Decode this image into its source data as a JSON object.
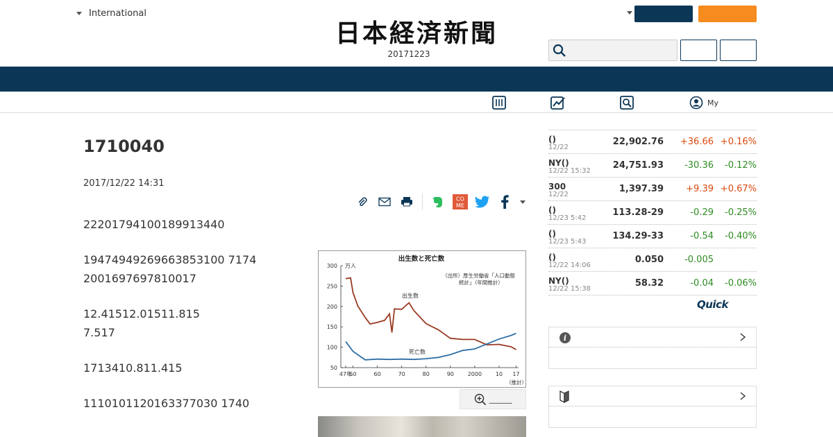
{
  "header": {
    "region_label": "International",
    "logo_text": "日本経済新聞",
    "date": "20171223",
    "search_placeholder": ""
  },
  "subnav": {
    "items": [
      {
        "icon": "keypad-icon",
        "label": ""
      },
      {
        "icon": "chart-icon",
        "label": ""
      },
      {
        "icon": "search-icon",
        "label": ""
      },
      {
        "icon": "user-icon",
        "label": "My"
      }
    ]
  },
  "article": {
    "title": "1710040",
    "date": "2017/12/22 14:31",
    "paragraphs": [
      [
        "22201794100189913440"
      ],
      [
        "19474949269663853100 7174",
        "2001697697810017"
      ],
      [
        "12.41512.01511.815",
        "7.517"
      ],
      [
        "1713410.811.415"
      ],
      [
        "1110101120163377030 1740"
      ]
    ],
    "zoom_label": "______"
  },
  "share": {
    "icons": [
      "clip-icon",
      "mail-icon",
      "print-icon",
      "evernote-icon",
      "come-icon",
      "twitter-icon",
      "facebook-icon"
    ],
    "come_text": "CO\nME"
  },
  "figure_text": {
    "title": "出生数と死亡数",
    "unit": "万人",
    "source_line1": "（出所）厚生労働省「人口動態",
    "source_line2": "統計」（年間推計）",
    "births_label": "出生数",
    "deaths_label": "死亡数",
    "est_label": "（推計）"
  },
  "chart_data": {
    "type": "line",
    "title": "出生数と死亡数",
    "ylabel": "万人",
    "ylim": [
      50,
      300
    ],
    "yticks": [
      50,
      100,
      150,
      200,
      250,
      300
    ],
    "xticks": [
      "47年",
      "50",
      "60",
      "70",
      "80",
      "90",
      "2000",
      "10",
      "17"
    ],
    "grid": false,
    "series": [
      {
        "name": "出生数",
        "color": "#9a3a22",
        "x": [
          1947,
          1949,
          1950,
          1952,
          1955,
          1957,
          1960,
          1963,
          1965,
          1966,
          1967,
          1970,
          1973,
          1975,
          1980,
          1985,
          1990,
          1995,
          2000,
          2005,
          2010,
          2015,
          2017
        ],
        "y": [
          268,
          270,
          234,
          201,
          173,
          157,
          161,
          166,
          182,
          136,
          194,
          193,
          209,
          190,
          158,
          143,
          122,
          119,
          119,
          106,
          107,
          101,
          94
        ]
      },
      {
        "name": "死亡数",
        "color": "#2f6ea5",
        "x": [
          1947,
          1950,
          1955,
          1960,
          1965,
          1970,
          1975,
          1980,
          1985,
          1990,
          1995,
          2000,
          2005,
          2010,
          2015,
          2017
        ],
        "y": [
          114,
          90,
          69,
          71,
          70,
          71,
          70,
          72,
          75,
          82,
          92,
          96,
          108,
          120,
          129,
          134
        ]
      }
    ]
  },
  "market": [
    {
      "name": "()",
      "time": "12/22",
      "price": "22,902.76",
      "change": "+36.66",
      "pct": "+0.16%",
      "dir": "up"
    },
    {
      "name": "NY()",
      "time": "12/22 15:32",
      "price": "24,751.93",
      "change": "-30.36",
      "pct": "-0.12%",
      "dir": "down"
    },
    {
      "name": "300",
      "time": "12/22",
      "price": "1,397.39",
      "change": "+9.39",
      "pct": "+0.67%",
      "dir": "up"
    },
    {
      "name": "()",
      "time": "12/23 5:42",
      "price": "113.28-29",
      "change": "-0.29",
      "pct": "-0.25%",
      "dir": "down"
    },
    {
      "name": "()",
      "time": "12/23 5:43",
      "price": "134.29-33",
      "change": "-0.54",
      "pct": "-0.40%",
      "dir": "down"
    },
    {
      "name": "()",
      "time": "12/22 14:06",
      "price": "0.050",
      "change": "-0.005",
      "pct": "",
      "dir": "down"
    },
    {
      "name": "NY()",
      "time": "12/22 15:38",
      "price": "58.32",
      "change": "-0.04",
      "pct": "-0.06%",
      "dir": "down"
    }
  ],
  "quick_logo": "Quick",
  "colors": {
    "navy": "#0c3656",
    "orange": "#f68b1e",
    "up": "#d9480f",
    "down": "#2e8b22"
  }
}
